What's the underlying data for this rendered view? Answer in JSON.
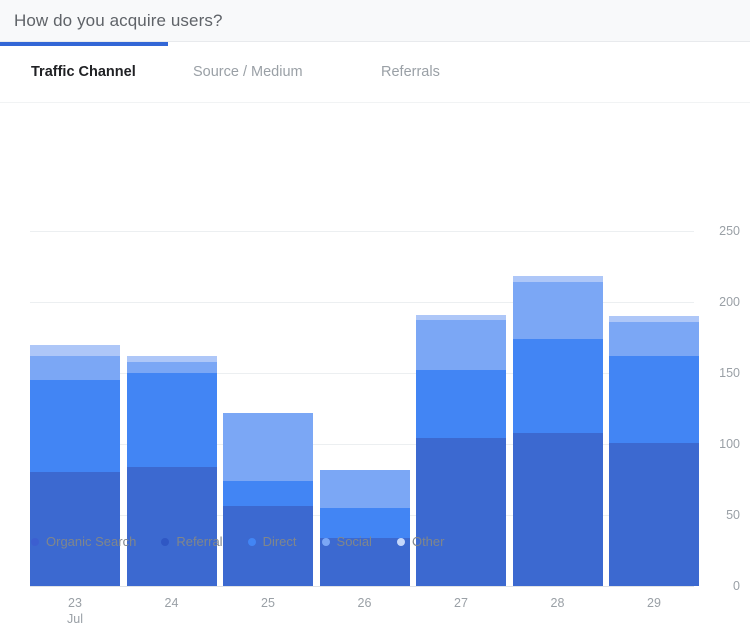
{
  "header": {
    "title": "How do you acquire users?"
  },
  "tabs": [
    {
      "label": "Traffic Channel",
      "active": true
    },
    {
      "label": "Source / Medium",
      "active": false
    },
    {
      "label": "Referrals",
      "active": false
    }
  ],
  "colors": {
    "accent": "#3367d6",
    "header_bg": "#f8f9fa",
    "organic_search": "#3c69d0",
    "referral": "#2f57c4",
    "direct": "#4285f4",
    "social": "#7ba7f5",
    "other": "#aec7f8",
    "gridline": "#eceff1",
    "axis_text": "#9aa0a6"
  },
  "legend": [
    {
      "label": "Organic Search",
      "color": "#3c5fd0"
    },
    {
      "label": "Referral",
      "color": "#2f57c4"
    },
    {
      "label": "Direct",
      "color": "#4285f4"
    },
    {
      "label": "Social",
      "color": "#7ba7f5"
    },
    {
      "label": "Other",
      "color": "#c5d7fb"
    }
  ],
  "chart_data": {
    "type": "bar",
    "stacked": true,
    "title": "How do you acquire users?",
    "xlabel": "",
    "ylabel": "",
    "ylim": [
      0,
      250
    ],
    "yticks": [
      0,
      50,
      100,
      150,
      200,
      250
    ],
    "grid": true,
    "legend_position": "bottom",
    "categories": [
      "23",
      "24",
      "25",
      "26",
      "27",
      "28",
      "29"
    ],
    "category_sublabels": [
      "Jul",
      "",
      "",
      "",
      "",
      "",
      ""
    ],
    "series": [
      {
        "name": "Organic Search",
        "color": "#3c69d0",
        "values": [
          80,
          84,
          56,
          34,
          104,
          108,
          101
        ]
      },
      {
        "name": "Referral",
        "color": "#2f57c4",
        "values": [
          0,
          0,
          0,
          0,
          0,
          0,
          0
        ]
      },
      {
        "name": "Direct",
        "color": "#4285f4",
        "values": [
          65,
          66,
          18,
          21,
          48,
          66,
          61
        ]
      },
      {
        "name": "Social",
        "color": "#7ba7f5",
        "values": [
          17,
          8,
          48,
          27,
          35,
          40,
          24
        ]
      },
      {
        "name": "Other",
        "color": "#aec7f8",
        "values": [
          8,
          4,
          0,
          0,
          4,
          4,
          4
        ]
      }
    ],
    "totals": [
      170,
      162,
      122,
      82,
      191,
      218,
      190
    ]
  }
}
